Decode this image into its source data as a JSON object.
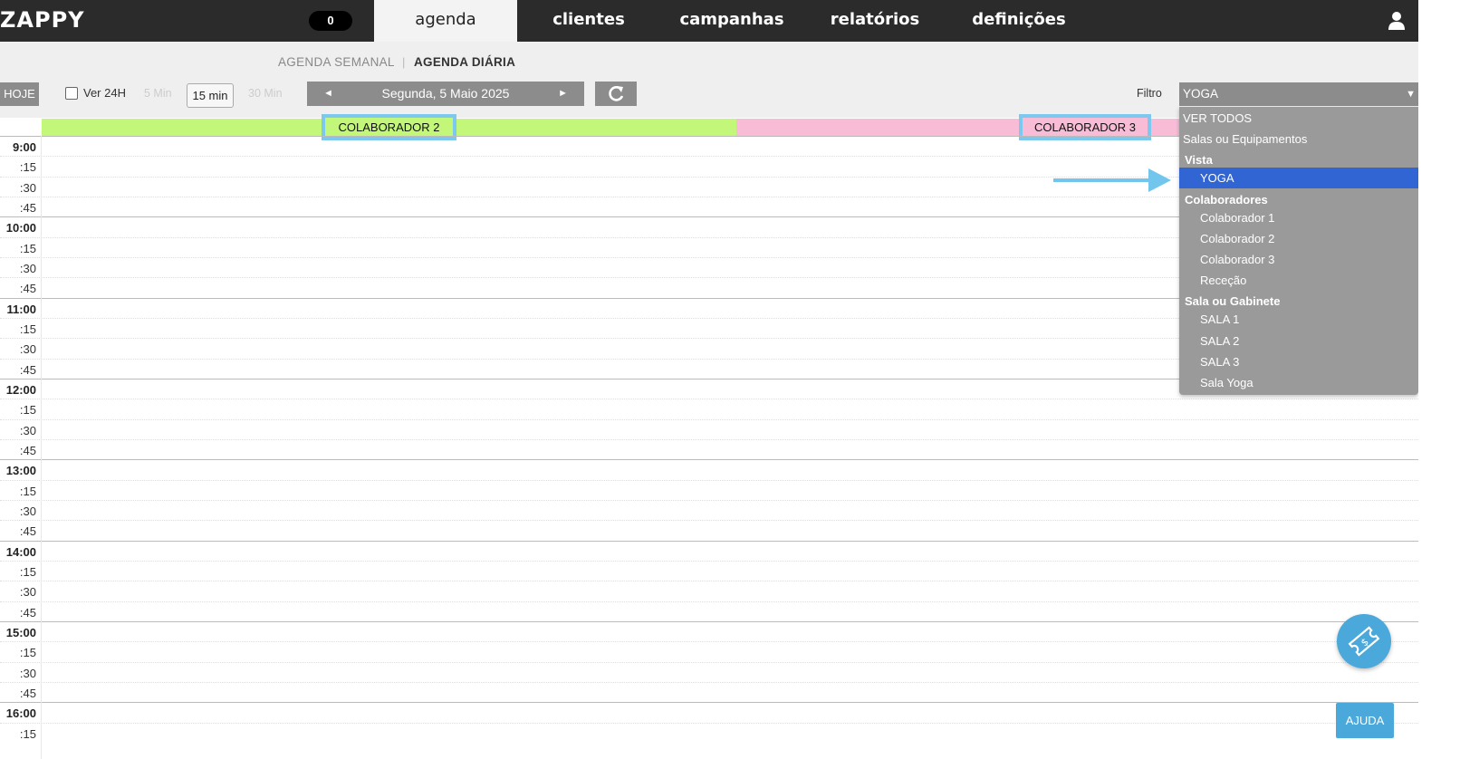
{
  "header": {
    "logo": "ZAPPY",
    "counter": "0",
    "tabs": [
      {
        "label": "agenda",
        "active": true
      },
      {
        "label": "clientes",
        "active": false
      },
      {
        "label": "campanhas",
        "active": false
      },
      {
        "label": "relatórios",
        "active": false
      },
      {
        "label": "definições",
        "active": false
      }
    ],
    "user_icon": "user-icon"
  },
  "views": {
    "weekly": "AGENDA SEMANAL",
    "separator": "|",
    "daily": "AGENDA DIÁRIA"
  },
  "toolbar": {
    "today": "HOJE",
    "show_24h": "Ver 24H",
    "intervals": [
      "5 Min",
      "15 min",
      "30 Min"
    ],
    "selected_interval": "15 min",
    "date": "Segunda, 5 Maio 2025",
    "prev_icon": "◄",
    "next_icon": "►",
    "refresh_icon": "refresh-icon",
    "filter_label": "Filtro",
    "filter_value": "YOGA",
    "filter_caret": "▼"
  },
  "columns": [
    {
      "label": "COLABORADOR 2",
      "color": "#c3f77a"
    },
    {
      "label": "COLABORADOR 3",
      "color": "#f8bcd7"
    }
  ],
  "time_slots": [
    "9:00",
    ":15",
    ":30",
    ":45",
    "10:00",
    ":15",
    ":30",
    ":45",
    "11:00",
    ":15",
    ":30",
    ":45",
    "12:00",
    ":15",
    ":30",
    ":45",
    "13:00",
    ":15",
    ":30",
    ":45",
    "14:00",
    ":15",
    ":30",
    ":45",
    "15:00",
    ":15",
    ":30",
    ":45",
    "16:00",
    ":15"
  ],
  "filter_dropdown": [
    {
      "label": "VER TODOS",
      "kind": "top"
    },
    {
      "label": "Salas ou Equipamentos",
      "kind": "top"
    },
    {
      "label": "Vista",
      "kind": "group"
    },
    {
      "label": "YOGA",
      "kind": "opt",
      "selected": true
    },
    {
      "label": "Colaboradores",
      "kind": "group"
    },
    {
      "label": "Colaborador 1",
      "kind": "opt"
    },
    {
      "label": "Colaborador 2",
      "kind": "opt"
    },
    {
      "label": "Colaborador 3",
      "kind": "opt"
    },
    {
      "label": "Receção",
      "kind": "opt"
    },
    {
      "label": "Sala ou Gabinete",
      "kind": "group"
    },
    {
      "label": "SALA 1",
      "kind": "opt"
    },
    {
      "label": "SALA 2",
      "kind": "opt"
    },
    {
      "label": "SALA 3",
      "kind": "opt"
    },
    {
      "label": "Sala Yoga",
      "kind": "opt"
    }
  ],
  "help": {
    "label": "AJUDA",
    "fab_icon": "ticket-icon"
  },
  "colors": {
    "topbar": "#2b2b2b",
    "accent": "#4aa8da",
    "highlight": "#7cc8ee",
    "selected": "#3165d4"
  }
}
